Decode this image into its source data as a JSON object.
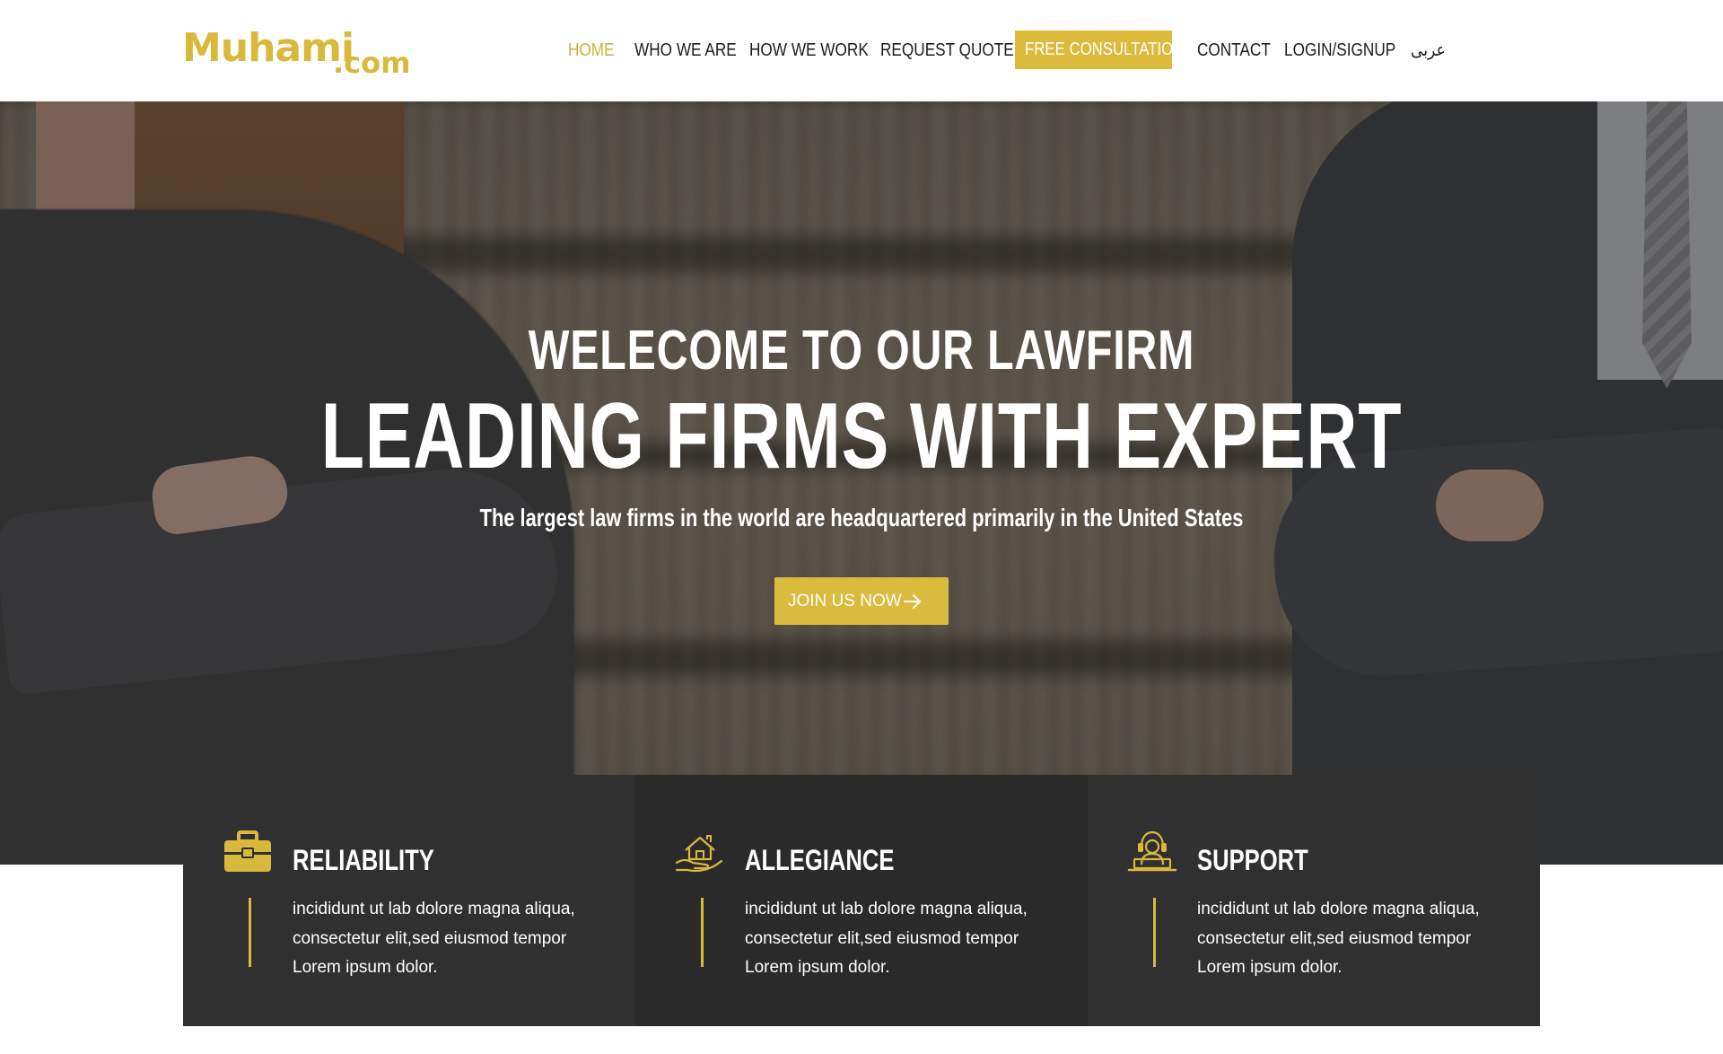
{
  "brand": {
    "logo_main": "Muhami",
    "logo_suffix": ".com",
    "accent_color": "#dbbb3e"
  },
  "nav": {
    "items": [
      {
        "label": "HOME",
        "active": true
      },
      {
        "label": "WHO WE ARE",
        "active": false
      },
      {
        "label": "HOW WE WORK",
        "active": false
      },
      {
        "label": "REQUEST QUOTE",
        "active": false
      },
      {
        "label": "FREE CONSULTATION",
        "active": false,
        "highlighted": true
      },
      {
        "label": "CONTACT",
        "active": false
      },
      {
        "label": "LOGIN/SIGNUP",
        "active": false
      },
      {
        "label": "عربى",
        "active": false
      }
    ]
  },
  "hero": {
    "kicker": "WELECOME TO OUR LAWFIRM",
    "headline": "LEADING FIRMS WITH EXPERT",
    "subtitle": "The largest law firms in the world are headquartered primarily in the United States",
    "cta_label": "JOIN US NOW",
    "cta_icon": "arrow-right-icon"
  },
  "features": [
    {
      "title": "RELIABILITY",
      "icon": "briefcase-icon",
      "lines": [
        "incididunt ut lab dolore magna aliqua,",
        "consectetur elit,sed eiusmod tempor",
        "Lorem ipsum dolor."
      ]
    },
    {
      "title": "ALLEGIANCE",
      "icon": "house-in-hand-icon",
      "lines": [
        "incididunt ut lab dolore magna aliqua,",
        "consectetur elit,sed eiusmod tempor",
        "Lorem ipsum dolor."
      ]
    },
    {
      "title": "SUPPORT",
      "icon": "support-agent-icon",
      "lines": [
        "incididunt ut lab dolore magna aliqua,",
        "consectetur elit,sed eiusmod tempor",
        "Lorem ipsum dolor."
      ]
    }
  ]
}
